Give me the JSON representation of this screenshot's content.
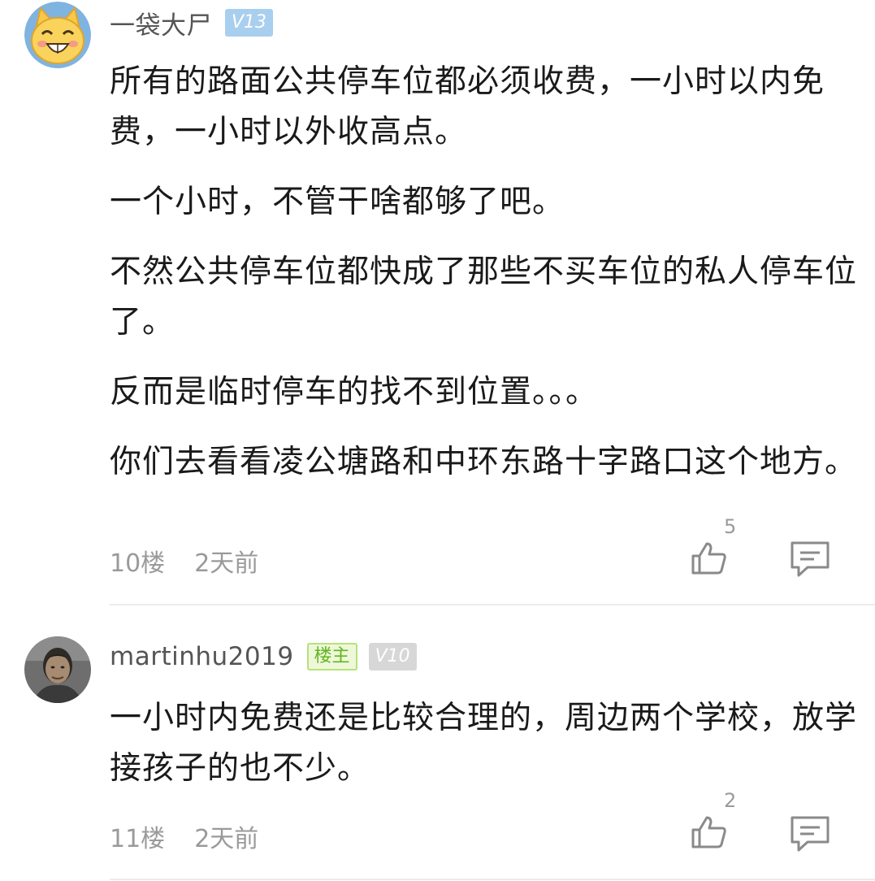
{
  "comments": [
    {
      "username": "一袋大尸",
      "level_badge": "V13",
      "paragraphs": [
        "所有的路面公共停车位都必须收费，一小时以内免费，一小时以外收高点。",
        "一个小时，不管干啥都够了吧。",
        "不然公共停车位都快成了那些不买车位的私人停车位了。",
        "反而是临时停车的找不到位置。。。",
        "你们去看看凌公塘路和中环东路十字路口这个地方。"
      ],
      "floor": "10楼",
      "time": "2天前",
      "likes": "5",
      "avatar": "cartoon-cat-avatar"
    },
    {
      "username": "martinhu2019",
      "owner_badge": "楼主",
      "level_badge": "V10",
      "paragraphs": [
        "一小时内免费还是比较合理的，周边两个学校，放学接孩子的也不少。"
      ],
      "floor": "11楼",
      "time": "2天前",
      "likes": "2",
      "avatar": "person-photo-avatar"
    }
  ],
  "icons": {
    "like": "thumbs-up-icon",
    "reply": "comment-icon"
  },
  "colors": {
    "owner_badge_green": "#63b51e",
    "level_badge_blue": "#a9cfef",
    "level_badge_grey": "#d7d7d7",
    "meta_grey": "#9a9a9a"
  }
}
